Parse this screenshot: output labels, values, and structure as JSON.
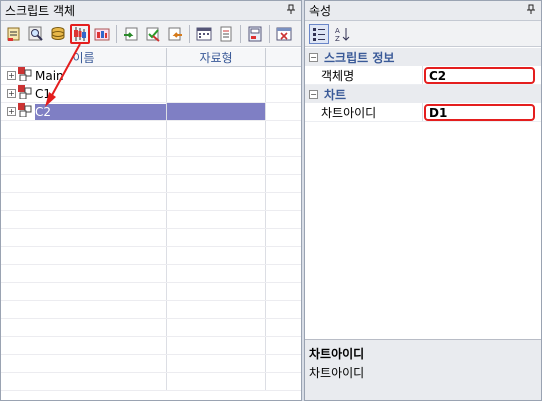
{
  "left_panel": {
    "title": "스크립트 객체",
    "pin_icon": "pin-icon",
    "toolbar": [
      {
        "name": "script-edit-icon",
        "highlighted": false
      },
      {
        "name": "search-icon",
        "highlighted": false
      },
      {
        "name": "database-icon",
        "highlighted": false
      },
      {
        "name": "candlestick-chart-icon",
        "highlighted": true
      },
      {
        "name": "chart-object-icon",
        "highlighted": false
      },
      {
        "name": "import-icon",
        "highlighted": false
      },
      {
        "name": "verify-icon",
        "highlighted": false
      },
      {
        "name": "export-icon",
        "highlighted": false
      },
      {
        "name": "calendar-icon",
        "highlighted": false
      },
      {
        "name": "document-icon",
        "highlighted": false
      },
      {
        "name": "save-icon",
        "highlighted": false
      },
      {
        "name": "close-window-icon",
        "highlighted": false
      }
    ],
    "columns": [
      "이름",
      "자료형"
    ],
    "tree": [
      {
        "label": "Main",
        "selected": false
      },
      {
        "label": "C1",
        "selected": false
      },
      {
        "label": "C2",
        "selected": true
      }
    ]
  },
  "right_panel": {
    "title": "속성",
    "categories": [
      {
        "label": "스크립트 정보",
        "props": [
          {
            "key": "객체명",
            "value": "C2"
          }
        ]
      },
      {
        "label": "차트",
        "props": [
          {
            "key": "차트아이디",
            "value": "D1"
          }
        ]
      }
    ],
    "description": {
      "title": "차트아이디",
      "text": "차트아이디"
    }
  },
  "colors": {
    "highlight": "#e41e1e",
    "selection": "#7f7fc4",
    "header_text": "#3a5a98"
  }
}
